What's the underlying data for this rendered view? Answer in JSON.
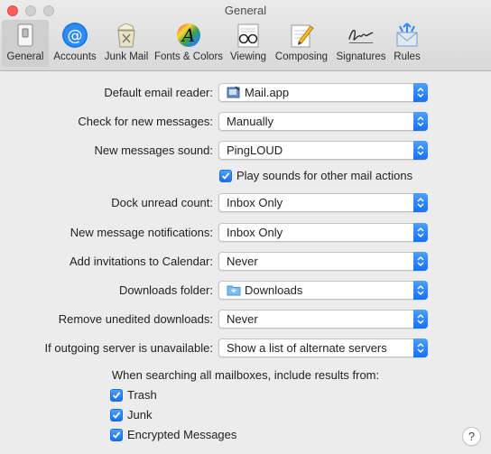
{
  "window": {
    "title": "General"
  },
  "toolbar": {
    "items": [
      {
        "label": "General",
        "icon": "general-switch-icon",
        "selected": true
      },
      {
        "label": "Accounts",
        "icon": "at-sign-icon"
      },
      {
        "label": "Junk Mail",
        "icon": "junk-trash-icon"
      },
      {
        "label": "Fonts & Colors",
        "icon": "fonts-colors-icon"
      },
      {
        "label": "Viewing",
        "icon": "eyeglasses-icon"
      },
      {
        "label": "Composing",
        "icon": "pencil-paper-icon"
      },
      {
        "label": "Signatures",
        "icon": "signature-icon"
      },
      {
        "label": "Rules",
        "icon": "rules-envelope-icon"
      }
    ]
  },
  "settings": {
    "default_email_reader": {
      "label": "Default email reader:",
      "value": "Mail.app",
      "icon": "mail-app-icon"
    },
    "check_new_messages": {
      "label": "Check for new messages:",
      "value": "Manually"
    },
    "new_messages_sound": {
      "label": "New messages sound:",
      "value": "PingLOUD"
    },
    "play_sounds": {
      "label": "Play sounds for other mail actions",
      "checked": true
    },
    "dock_unread_count": {
      "label": "Dock unread count:",
      "value": "Inbox Only"
    },
    "new_message_notifications": {
      "label": "New message notifications:",
      "value": "Inbox Only"
    },
    "add_invitations": {
      "label": "Add invitations to Calendar:",
      "value": "Never"
    },
    "downloads_folder": {
      "label": "Downloads folder:",
      "value": "Downloads",
      "icon": "folder-icon"
    },
    "remove_unedited": {
      "label": "Remove unedited downloads:",
      "value": "Never"
    },
    "outgoing_unavailable": {
      "label": "If outgoing server is unavailable:",
      "value": "Show a list of alternate servers"
    }
  },
  "search": {
    "heading": "When searching all mailboxes, include results from:",
    "options": [
      {
        "label": "Trash",
        "checked": true
      },
      {
        "label": "Junk",
        "checked": true
      },
      {
        "label": "Encrypted Messages",
        "checked": true
      }
    ]
  },
  "help": {
    "label": "?"
  },
  "colors": {
    "accent": "#1670f1",
    "close_button": "#fc605b",
    "background": "#ececec"
  }
}
